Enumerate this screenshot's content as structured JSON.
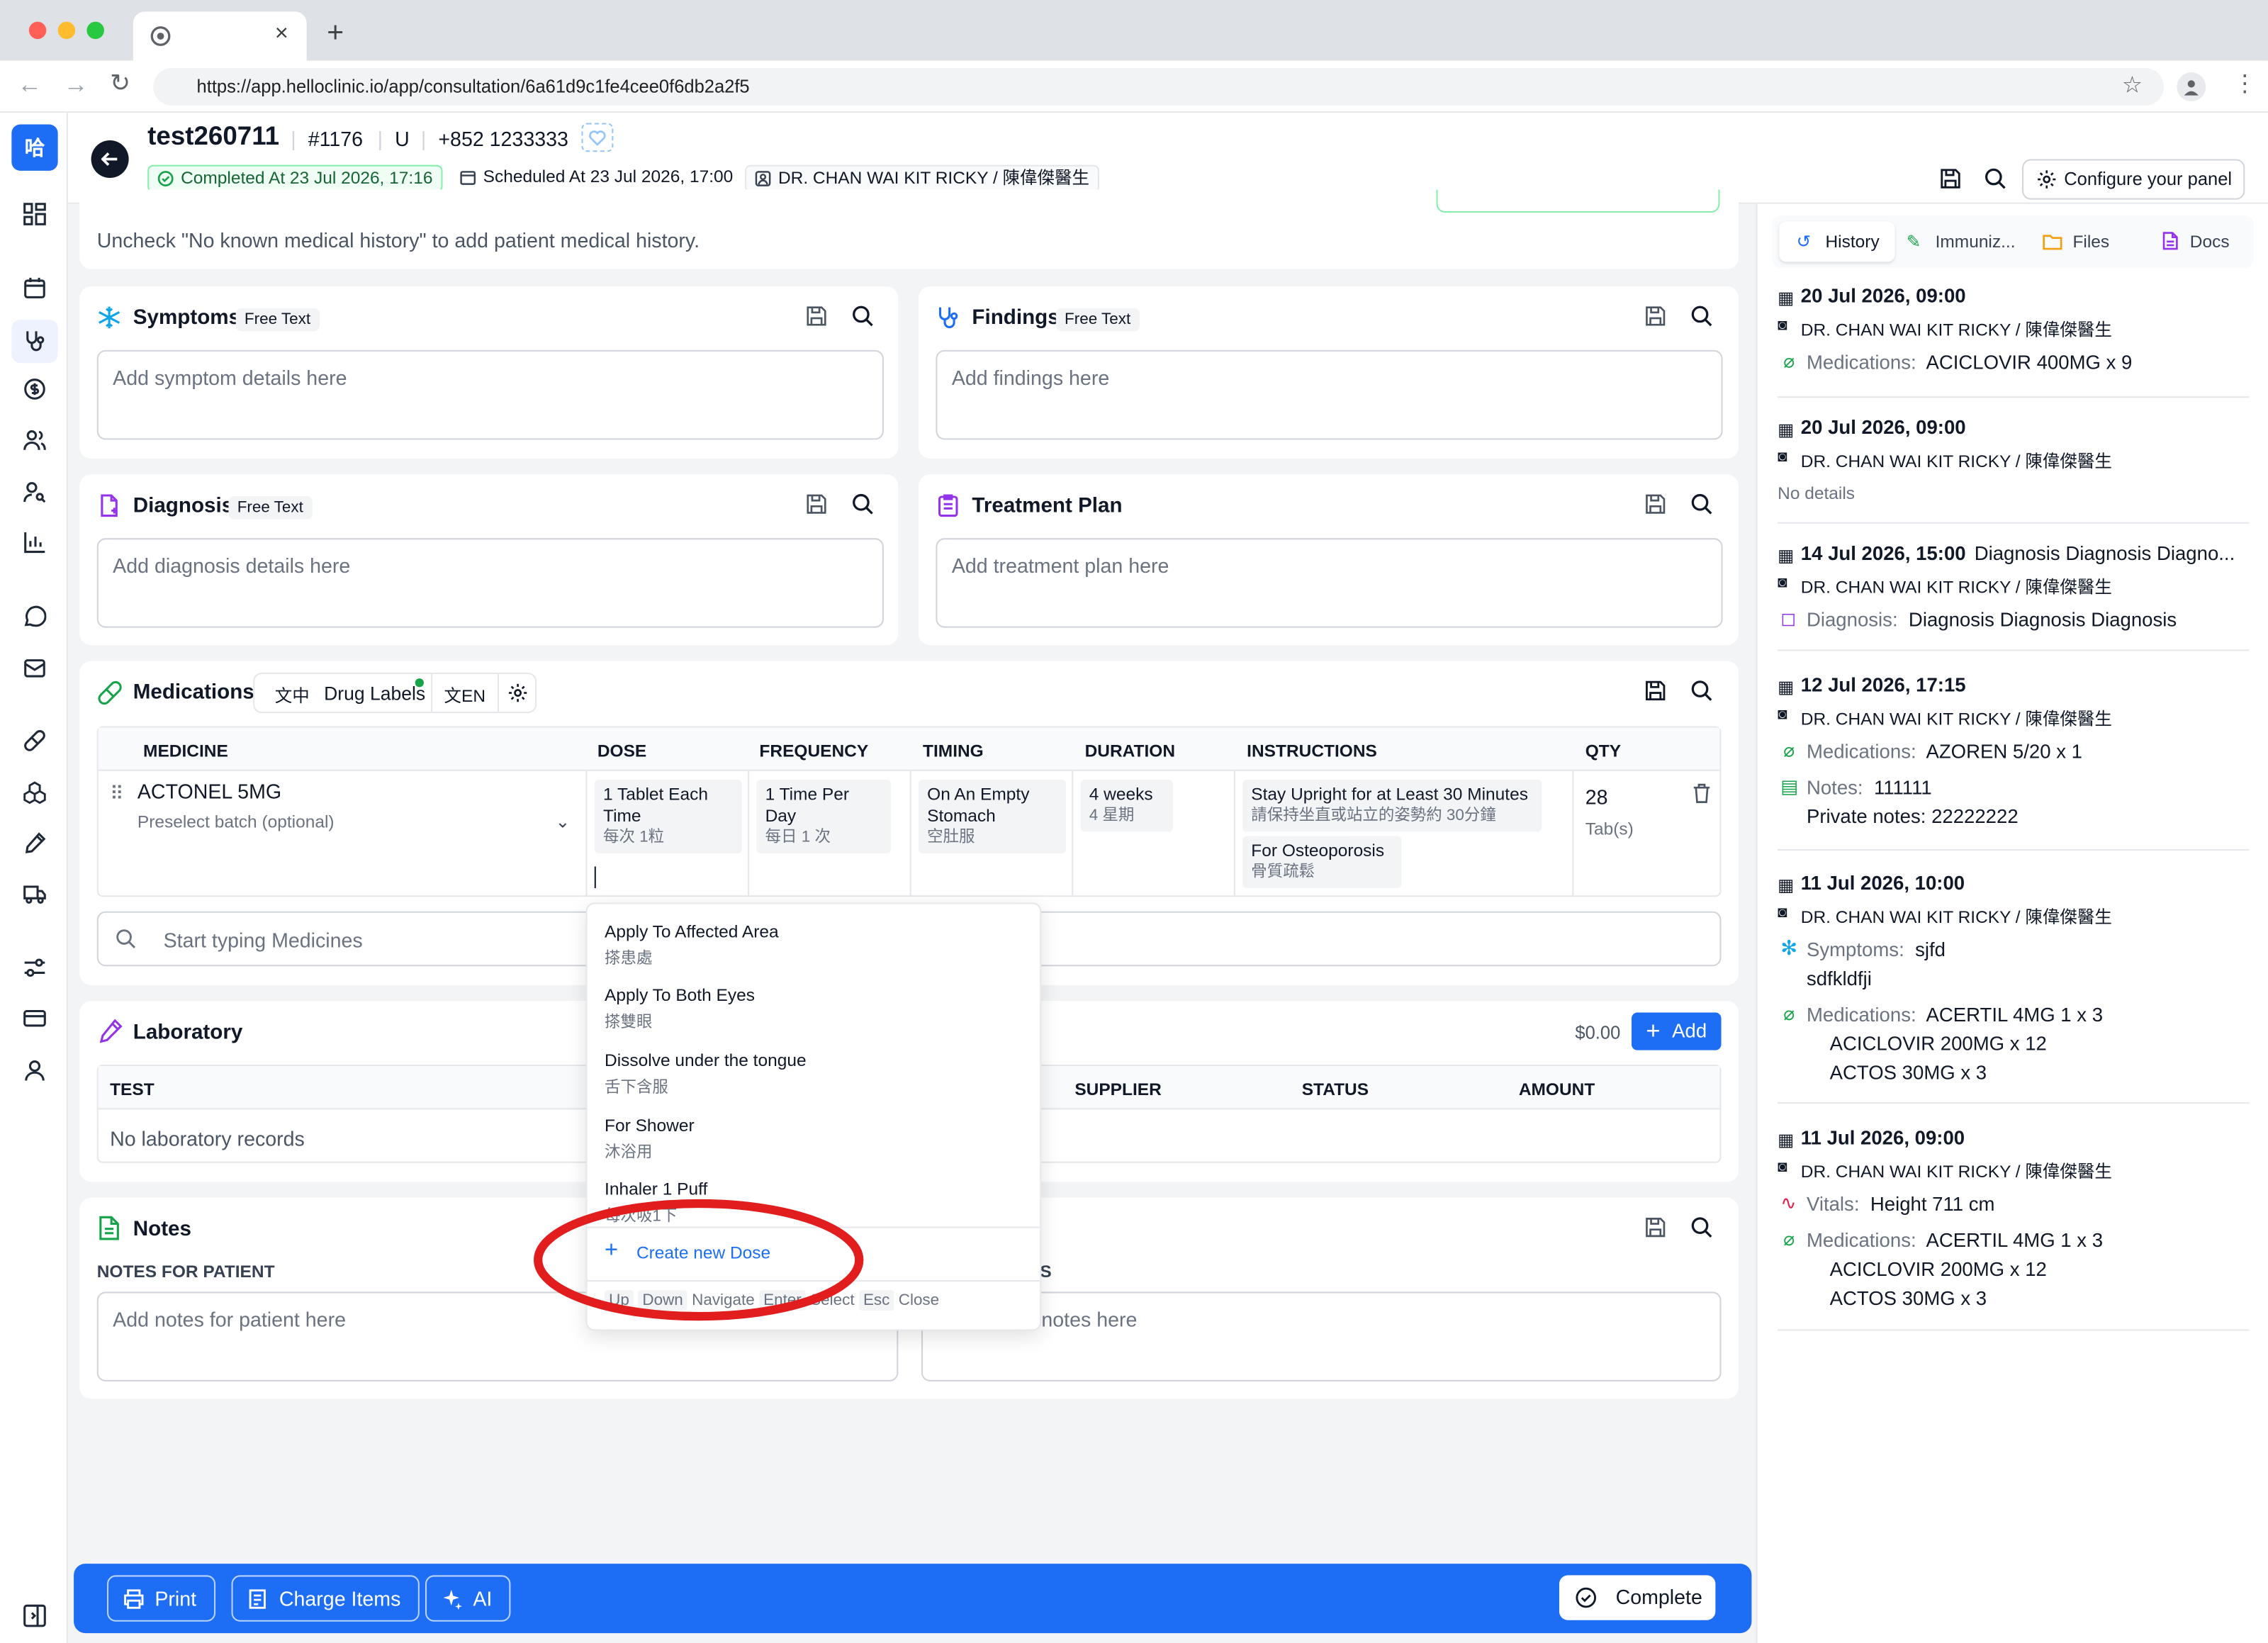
{
  "browser": {
    "url": "https://app.helloclinic.io/app/consultation/6a61d9c1fe4cee0f6db2a2f5"
  },
  "sidebar": {
    "logo": "哈"
  },
  "header": {
    "patient_name": "test260711",
    "patient_id": "#1176",
    "gender": "U",
    "phone": "+852 1233333",
    "completed": "Completed At  23 Jul 2026, 17:16",
    "scheduled": "Scheduled At  23 Jul 2026, 17:00",
    "doctor": "DR. CHAN WAI KIT RICKY / 陳偉傑醫生",
    "configure_label": "Configure your panel"
  },
  "history_notice": "Uncheck \"No known medical history\" to add patient medical history.",
  "symptoms": {
    "title": "Symptoms",
    "badge": "Free Text",
    "placeholder": "Add symptom details here"
  },
  "findings": {
    "title": "Findings",
    "badge": "Free Text",
    "placeholder": "Add findings here"
  },
  "diagnosis": {
    "title": "Diagnosis",
    "badge": "Free Text",
    "placeholder": "Add diagnosis details here"
  },
  "treatment": {
    "title": "Treatment Plan",
    "placeholder": "Add treatment plan here"
  },
  "medications": {
    "title": "Medications",
    "drug_labels": "Drug Labels",
    "lang_zh": "中",
    "lang_en": "EN",
    "columns": [
      "MEDICINE",
      "DOSE",
      "FREQUENCY",
      "TIMING",
      "DURATION",
      "INSTRUCTIONS",
      "QTY"
    ],
    "row": {
      "medicine": "ACTONEL 5MG",
      "batch_placeholder": "Preselect batch (optional)",
      "dose_en": "1 Tablet Each Time",
      "dose_zh": "每次 1粒",
      "freq_en": "1 Time Per Day",
      "freq_zh": "每日 1 次",
      "timing_en": "On An Empty Stomach",
      "timing_zh": "空肚服",
      "duration_en": "4 weeks",
      "duration_zh": "4 星期",
      "instr1_en": "Stay Upright for at Least 30 Minutes",
      "instr1_zh": "請保持坐直或站立的姿勢約 30分鐘",
      "instr2_en": "For Osteoporosis",
      "instr2_zh": "骨質疏鬆",
      "qty": "28",
      "unit": "Tab(s)"
    },
    "search_placeholder": "Start typing Medicines"
  },
  "dose_dropdown": {
    "options": [
      {
        "en": "Apply To Affected Area",
        "zh": "搽患處"
      },
      {
        "en": "Apply To Both Eyes",
        "zh": "搽雙眼"
      },
      {
        "en": "Dissolve under the tongue",
        "zh": "舌下含服"
      },
      {
        "en": "For Shower",
        "zh": "沐浴用"
      },
      {
        "en": "Inhaler 1 Puff",
        "zh": "每次吸1下"
      }
    ],
    "create_label": "Create new Dose",
    "hint": {
      "up": "Up",
      "down": "Down",
      "navigate": "Navigate",
      "enter": "Enter",
      "select": "Select",
      "esc": "Esc",
      "close": "Close"
    }
  },
  "laboratory": {
    "title": "Laboratory",
    "total": "$0.00",
    "add_label": "Add",
    "columns": [
      "TEST",
      "SUPPLIER",
      "STATUS",
      "AMOUNT"
    ],
    "empty": "No laboratory records"
  },
  "notes": {
    "title": "Notes",
    "patient_label": "NOTES FOR PATIENT",
    "patient_placeholder": "Add notes for patient here",
    "private_label_fragment": "S",
    "private_placeholder_fragment": "notes here"
  },
  "bottom_bar": {
    "print": "Print",
    "charge": "Charge Items",
    "ai": "AI",
    "complete": "Complete"
  },
  "right_tabs": [
    "History",
    "Immuniz...",
    "Files",
    "Docs"
  ],
  "history": [
    {
      "date": "20 Jul 2026, 09:00",
      "doctor": "DR. CHAN WAI KIT RICKY / 陳偉傑醫生",
      "lines": [
        {
          "label": "Medications:",
          "value": "ACICLOVIR 400MG x 9"
        }
      ]
    },
    {
      "date": "20 Jul 2026, 09:00",
      "doctor": "DR. CHAN WAI KIT RICKY / 陳偉傑醫生",
      "no_details": "No details"
    },
    {
      "date": "14 Jul 2026, 15:00",
      "title": "Diagnosis Diagnosis Diagno...",
      "doctor": "DR. CHAN WAI KIT RICKY / 陳偉傑醫生",
      "lines": [
        {
          "label": "Diagnosis:",
          "value": "Diagnosis Diagnosis Diagnosis"
        }
      ]
    },
    {
      "date": "12 Jul 2026, 17:15",
      "doctor": "DR. CHAN WAI KIT RICKY / 陳偉傑醫生",
      "lines": [
        {
          "label": "Medications:",
          "value": "AZOREN 5/20 x 1"
        },
        {
          "label": "Notes:",
          "value": "111111"
        }
      ],
      "private": "Private notes: 22222222"
    },
    {
      "date": "11 Jul 2026, 10:00",
      "doctor": "DR. CHAN WAI KIT RICKY / 陳偉傑醫生",
      "symptoms": {
        "label": "Symptoms:",
        "value": "sjfd",
        "extra": "sdfkldfji"
      },
      "meds": {
        "label": "Medications:",
        "items": [
          "ACERTIL 4MG 1 x 3",
          "ACICLOVIR 200MG x 12",
          "ACTOS 30MG x 3"
        ]
      }
    },
    {
      "date": "11 Jul 2026, 09:00",
      "doctor": "DR. CHAN WAI KIT RICKY / 陳偉傑醫生",
      "vitals": {
        "label": "Vitals:",
        "value": "Height 711 cm"
      },
      "meds": {
        "label": "Medications:",
        "items": [
          "ACERTIL 4MG 1 x 3",
          "ACICLOVIR 200MG x 12",
          "ACTOS 30MG x 3"
        ]
      }
    }
  ],
  "colors": {
    "primary": "#1d6ef5",
    "success": "#16a34a",
    "annotation": "#e11d1d",
    "main_bg": "#f3f4f6"
  }
}
